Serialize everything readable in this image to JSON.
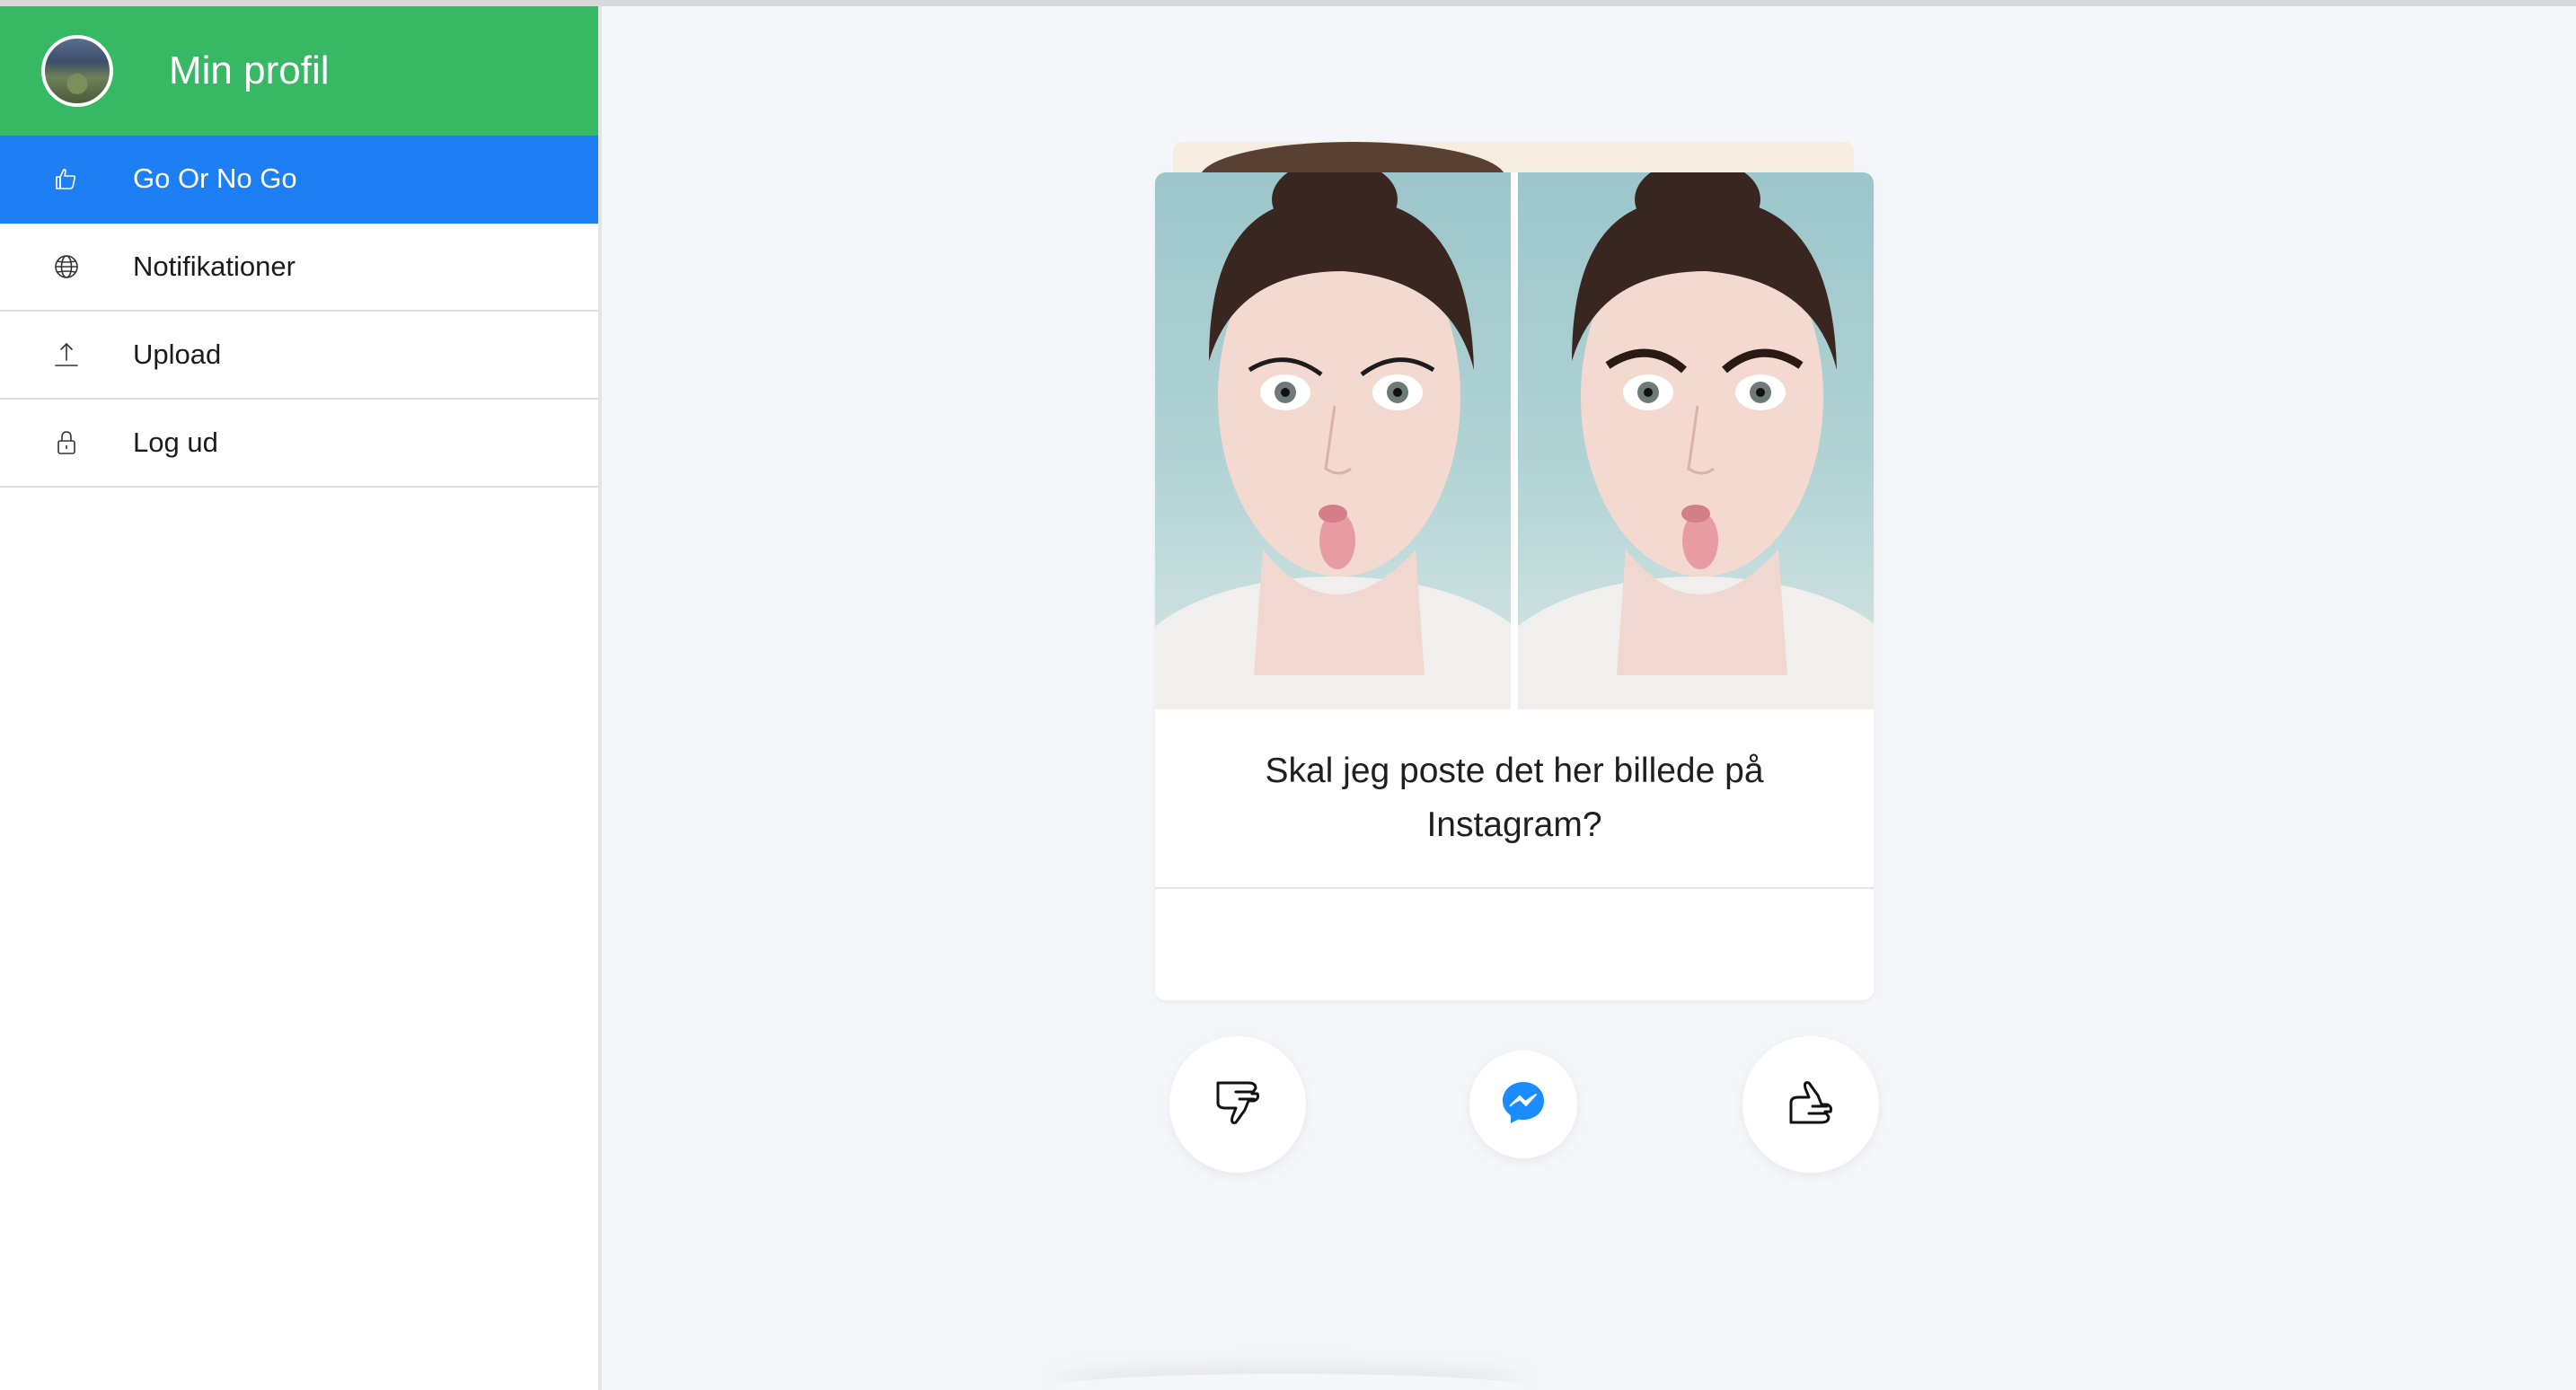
{
  "profile": {
    "name": "Min profil"
  },
  "nav": {
    "items": [
      {
        "label": "Go Or No Go",
        "icon": "thumbs-up-icon",
        "active": true
      },
      {
        "label": "Notifikationer",
        "icon": "globe-icon",
        "active": false
      },
      {
        "label": "Upload",
        "icon": "upload-icon",
        "active": false
      },
      {
        "label": "Log ud",
        "icon": "lock-icon",
        "active": false
      }
    ]
  },
  "card": {
    "question": "Skal jeg poste det her billede på Instagram?"
  },
  "actions": {
    "dislike_icon": "thumbs-down-icon",
    "share_icon": "messenger-icon",
    "like_icon": "thumbs-up-icon"
  },
  "colors": {
    "header_green": "#36b864",
    "active_blue": "#1e7ff5",
    "messenger_blue": "#1a8cff",
    "background": "#f5f6fa"
  }
}
